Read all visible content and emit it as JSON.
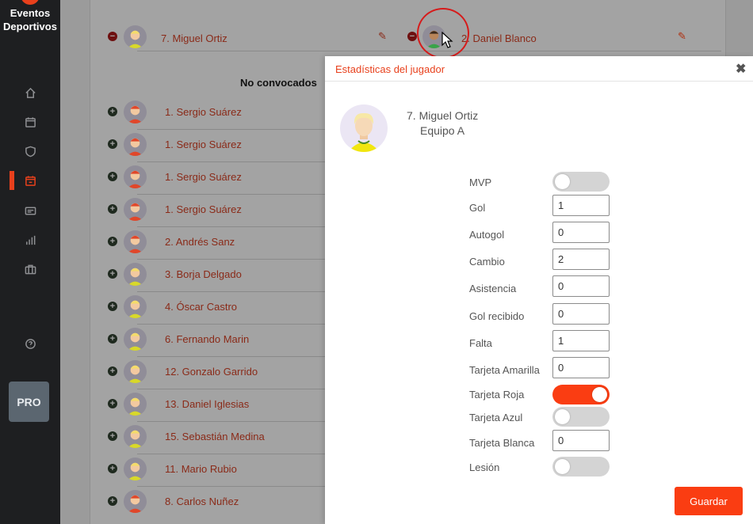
{
  "app": {
    "brand_line1": "Eventos",
    "brand_line2": "Deportivos",
    "pro_label": "PRO"
  },
  "sidebar": {
    "items": [
      {
        "icon": "home-icon"
      },
      {
        "icon": "calendar-icon"
      },
      {
        "icon": "shield-icon"
      },
      {
        "icon": "calendar-event-icon",
        "active": true
      },
      {
        "icon": "id-card-icon"
      },
      {
        "icon": "bar-chart-icon"
      },
      {
        "icon": "briefcase-icon"
      },
      {
        "icon": "help-icon"
      }
    ]
  },
  "lineup": {
    "called_left": {
      "name": "7. Miguel Ortiz"
    },
    "called_right": {
      "name": "2. Daniel Blanco"
    },
    "not_called_title": "No convocados",
    "not_called": [
      {
        "name": "1. Sergio Suárez",
        "avatar": "red-hair"
      },
      {
        "name": "1. Sergio Suárez",
        "avatar": "red-hair"
      },
      {
        "name": "1. Sergio Suárez",
        "avatar": "red-hair"
      },
      {
        "name": "1. Sergio Suárez",
        "avatar": "red-hair"
      },
      {
        "name": "2. Andrés Sanz",
        "avatar": "red-hair"
      },
      {
        "name": "3. Borja Delgado",
        "avatar": "blond"
      },
      {
        "name": "4. Óscar Castro",
        "avatar": "blond"
      },
      {
        "name": "6. Fernando Marin",
        "avatar": "blond"
      },
      {
        "name": "12. Gonzalo Garrido",
        "avatar": "blond"
      },
      {
        "name": "13. Daniel Iglesias",
        "avatar": "blond"
      },
      {
        "name": "15. Sebastián Medina",
        "avatar": "blond"
      },
      {
        "name": "11. Mario Rubio",
        "avatar": "blond"
      },
      {
        "name": "8. Carlos Nuñez",
        "avatar": "red-hair"
      }
    ]
  },
  "modal": {
    "title": "Estadísticas del jugador",
    "close_glyph": "✖",
    "player_name": "7. Miguel Ortiz",
    "player_team": "Equipo A",
    "stats": {
      "mvp": {
        "label": "MVP",
        "type": "toggle",
        "on": false
      },
      "gol": {
        "label": "Gol",
        "type": "input",
        "value": "1"
      },
      "autogol": {
        "label": "Autogol",
        "type": "input",
        "value": "0"
      },
      "cambio": {
        "label": "Cambio",
        "type": "input",
        "value": "2"
      },
      "asistencia": {
        "label": "Asistencia",
        "type": "input",
        "value": "0"
      },
      "gol_recibido": {
        "label": "Gol recibido",
        "type": "input",
        "value": "0"
      },
      "falta": {
        "label": "Falta",
        "type": "input",
        "value": "1"
      },
      "tarjeta_amarilla": {
        "label": "Tarjeta Amarilla",
        "type": "input",
        "value": "0"
      },
      "tarjeta_roja": {
        "label": "Tarjeta Roja",
        "type": "toggle",
        "on": true
      },
      "tarjeta_azul": {
        "label": "Tarjeta Azul",
        "type": "toggle",
        "on": false
      },
      "tarjeta_blanca": {
        "label": "Tarjeta Blanca",
        "type": "input",
        "value": "0"
      },
      "lesion": {
        "label": "Lesión",
        "type": "toggle",
        "on": false
      }
    },
    "save_label": "Guardar"
  },
  "colors": {
    "accent": "#fa3d12",
    "sidebar_bg": "#1e1f21",
    "overlay_bg": "#9b9b9b"
  }
}
